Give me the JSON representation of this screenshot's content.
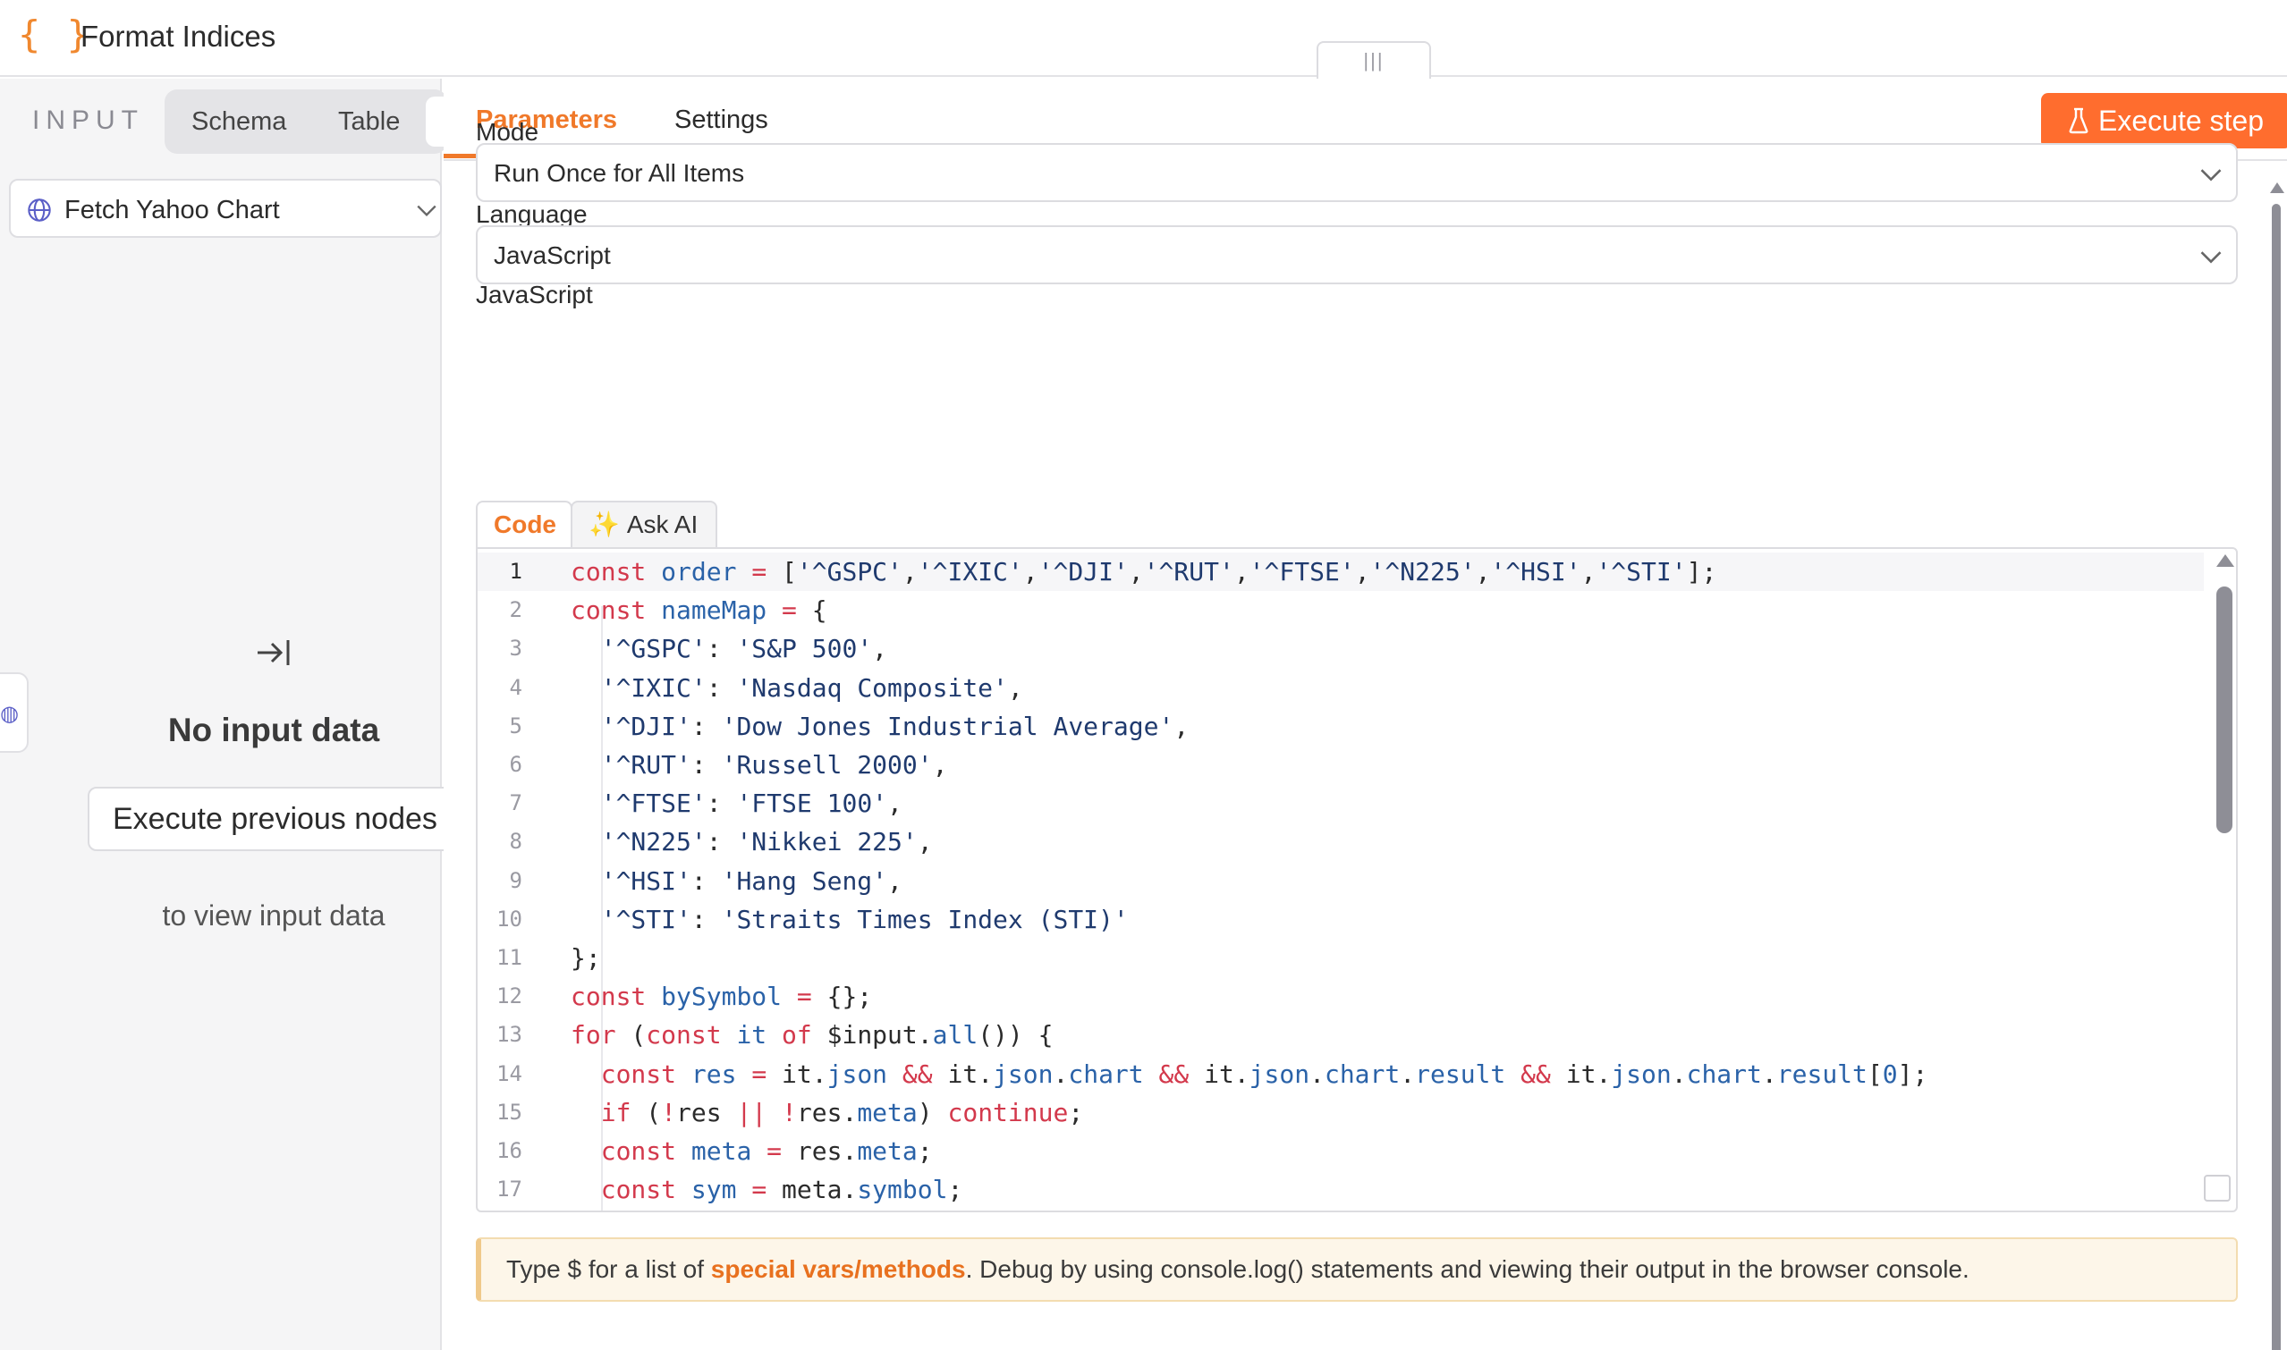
{
  "header": {
    "logo_glyph": "{ }",
    "title": "Format Indices",
    "drag_handle_glyph": "|||"
  },
  "input_panel": {
    "label": "INPUT",
    "view_tabs": [
      "Schema",
      "Table"
    ],
    "node_selector": {
      "icon": "globe-icon",
      "value": "Fetch Yahoo Chart"
    },
    "side_tab_icon": "globe-icon",
    "empty_state": {
      "icon": "arrow-to-right-icon",
      "title": "No input data",
      "button_label": "Execute previous nodes",
      "hint": "to view input data"
    }
  },
  "params_panel": {
    "tabs": [
      {
        "label": "Parameters",
        "active": true
      },
      {
        "label": "Settings",
        "active": false
      }
    ],
    "execute_button": {
      "label": "Execute step",
      "icon": "flask-icon",
      "color": "#ff6d2e"
    },
    "fields": {
      "mode": {
        "label": "Mode",
        "value": "Run Once for All Items"
      },
      "language": {
        "label": "Language",
        "value": "JavaScript"
      },
      "code_label": "JavaScript"
    },
    "editor_tabs": [
      {
        "label": "Code",
        "active": true
      },
      {
        "label": "Ask AI",
        "icon": "sparkle-icon",
        "active": false
      }
    ],
    "code_lines": [
      "const order = ['^GSPC','^IXIC','^DJI','^RUT','^FTSE','^N225','^HSI','^STI'];",
      "const nameMap = {",
      "  '^GSPC': 'S&P 500',",
      "  '^IXIC': 'Nasdaq Composite',",
      "  '^DJI': 'Dow Jones Industrial Average',",
      "  '^RUT': 'Russell 2000',",
      "  '^FTSE': 'FTSE 100',",
      "  '^N225': 'Nikkei 225',",
      "  '^HSI': 'Hang Seng',",
      "  '^STI': 'Straits Times Index (STI)'",
      "};",
      "const bySymbol = {};",
      "for (const it of $input.all()) {",
      "  const res = it.json && it.json.chart && it.json.chart.result && it.json.chart.result[0];",
      "  if (!res || !res.meta) continue;",
      "  const meta = res.meta;",
      "  const sym = meta.symbol;"
    ],
    "hint": {
      "prefix": "Type $ for a list of ",
      "link": "special vars/methods",
      "suffix": ". Debug by using console.log() statements and viewing their output in the browser console."
    }
  },
  "colors": {
    "accent": "#f0792a",
    "primary_button": "#ff6d2e",
    "keyword": "#d3394c",
    "identifier": "#2a62a8",
    "string": "#1f3a6e",
    "hint_bg": "#fdf6e9"
  }
}
